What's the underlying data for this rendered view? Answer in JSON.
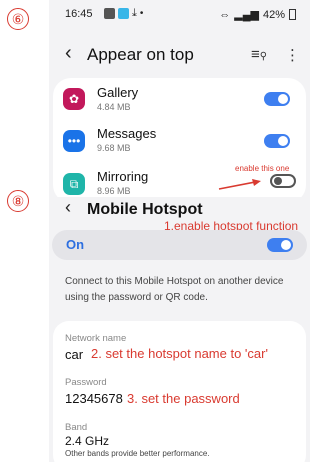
{
  "steps": {
    "step6": "⑥",
    "step8": "⑧"
  },
  "status_bar": {
    "time": "16:45",
    "dot": "•",
    "battery": "42%"
  },
  "appear_on_top": {
    "title": "Appear on top",
    "apps": [
      {
        "name": "Gallery",
        "size": "4.84 MB",
        "icon": "gallery-flower-icon",
        "color": "#c2185b",
        "enabled": true
      },
      {
        "name": "Messages",
        "size": "9.68 MB",
        "icon": "messages-bubble-icon",
        "color": "#1a73e8",
        "enabled": true
      },
      {
        "name": "Mirroring",
        "size": "8.96 MB",
        "icon": "mirroring-icon",
        "color": "#1fb5a9",
        "enabled": false
      }
    ],
    "annotation": "enable this one"
  },
  "mobile_hotspot": {
    "title": "Mobile Hotspot",
    "status_label": "On",
    "enabled": true,
    "description": "Connect to this Mobile Hotspot on another device using the password or QR code.",
    "network_name": {
      "label": "Network name",
      "value": "car"
    },
    "password": {
      "label": "Password",
      "value": "12345678"
    },
    "band": {
      "label": "Band",
      "value": "2.4 GHz",
      "note": "Other bands provide better performance."
    },
    "annotations": {
      "step1": "1.enable hotspot function",
      "step2": "2. set the hotspot name to 'car'",
      "step3": "3. set the password"
    }
  },
  "colors": {
    "accent": "#3e7ff0",
    "annotation": "#d93a30"
  }
}
